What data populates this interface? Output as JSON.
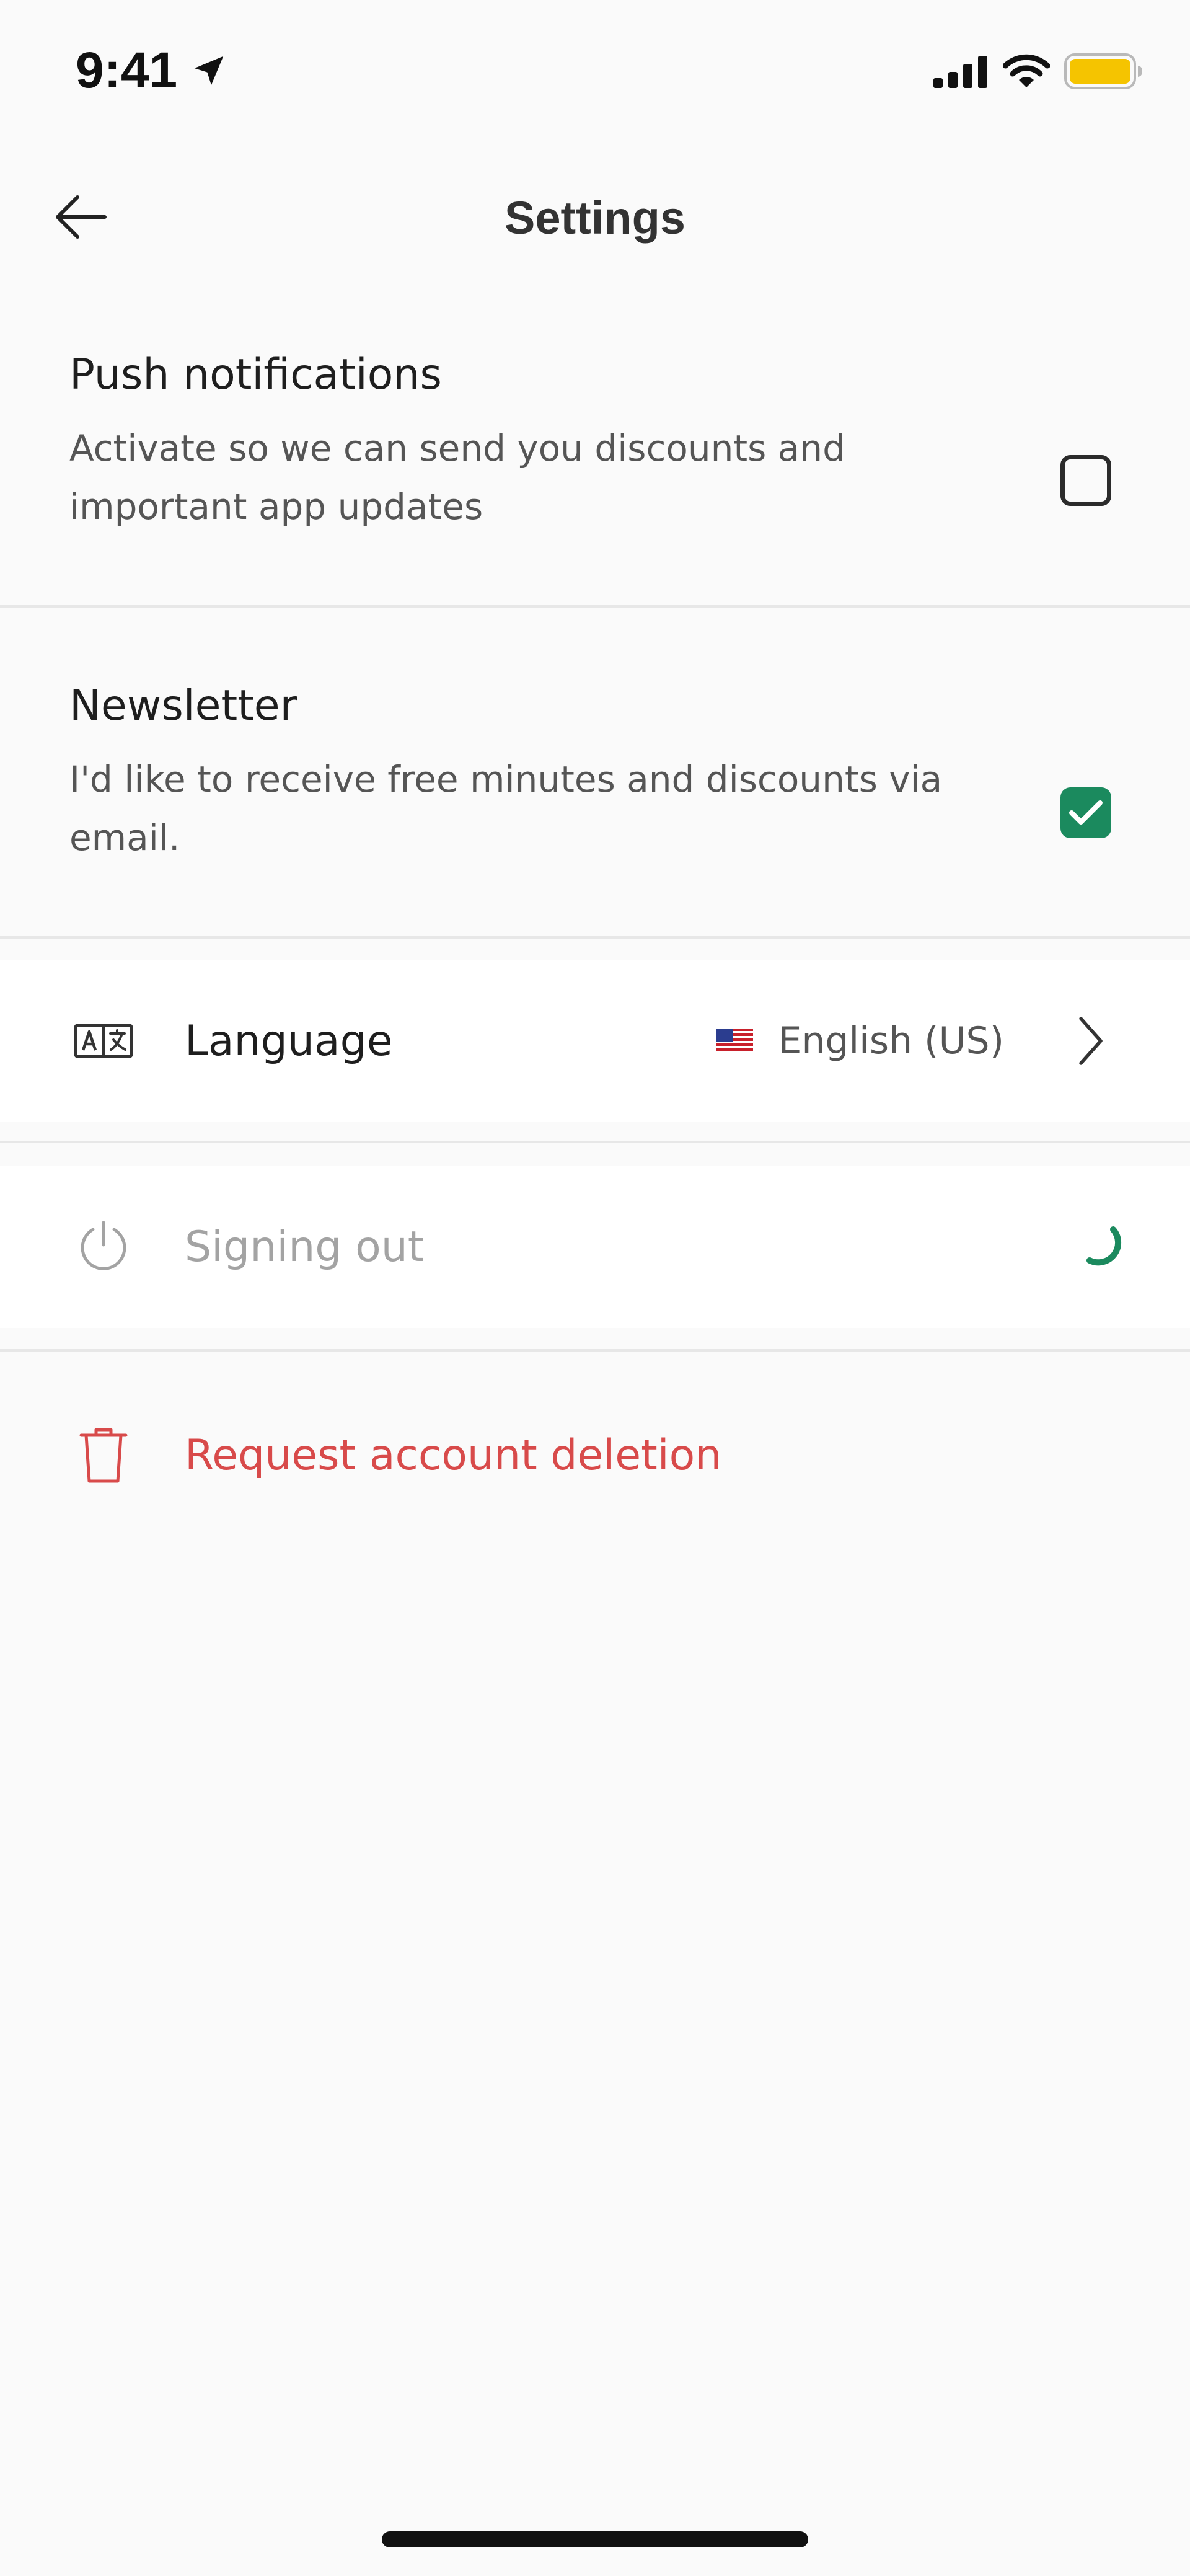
{
  "status_bar": {
    "time": "9:41",
    "icons": [
      "location-arrow-icon",
      "cellular-signal-icon",
      "wifi-icon",
      "battery-icon"
    ],
    "battery_color": "#f5c400"
  },
  "header": {
    "title": "Settings",
    "back_icon": "arrow-left-icon"
  },
  "push_notifications": {
    "title": "Push notifications",
    "description": "Activate so we can send you discounts and important app updates",
    "checked": false
  },
  "newsletter": {
    "title": "Newsletter",
    "description": "I'd like to receive free minutes and discounts via email.",
    "checked": true
  },
  "language": {
    "label": "Language",
    "icon": "translate-icon",
    "value": "English (US)",
    "flag_icon": "us-flag-icon"
  },
  "sign_out": {
    "label": "Signing out",
    "icon": "power-icon",
    "state": "loading"
  },
  "delete_account": {
    "label": "Request account deletion",
    "icon": "trash-icon"
  },
  "colors": {
    "accent": "#1b8a5e",
    "danger": "#d84a4a",
    "background": "#fafafa",
    "muted_text": "#a3a3a3"
  }
}
